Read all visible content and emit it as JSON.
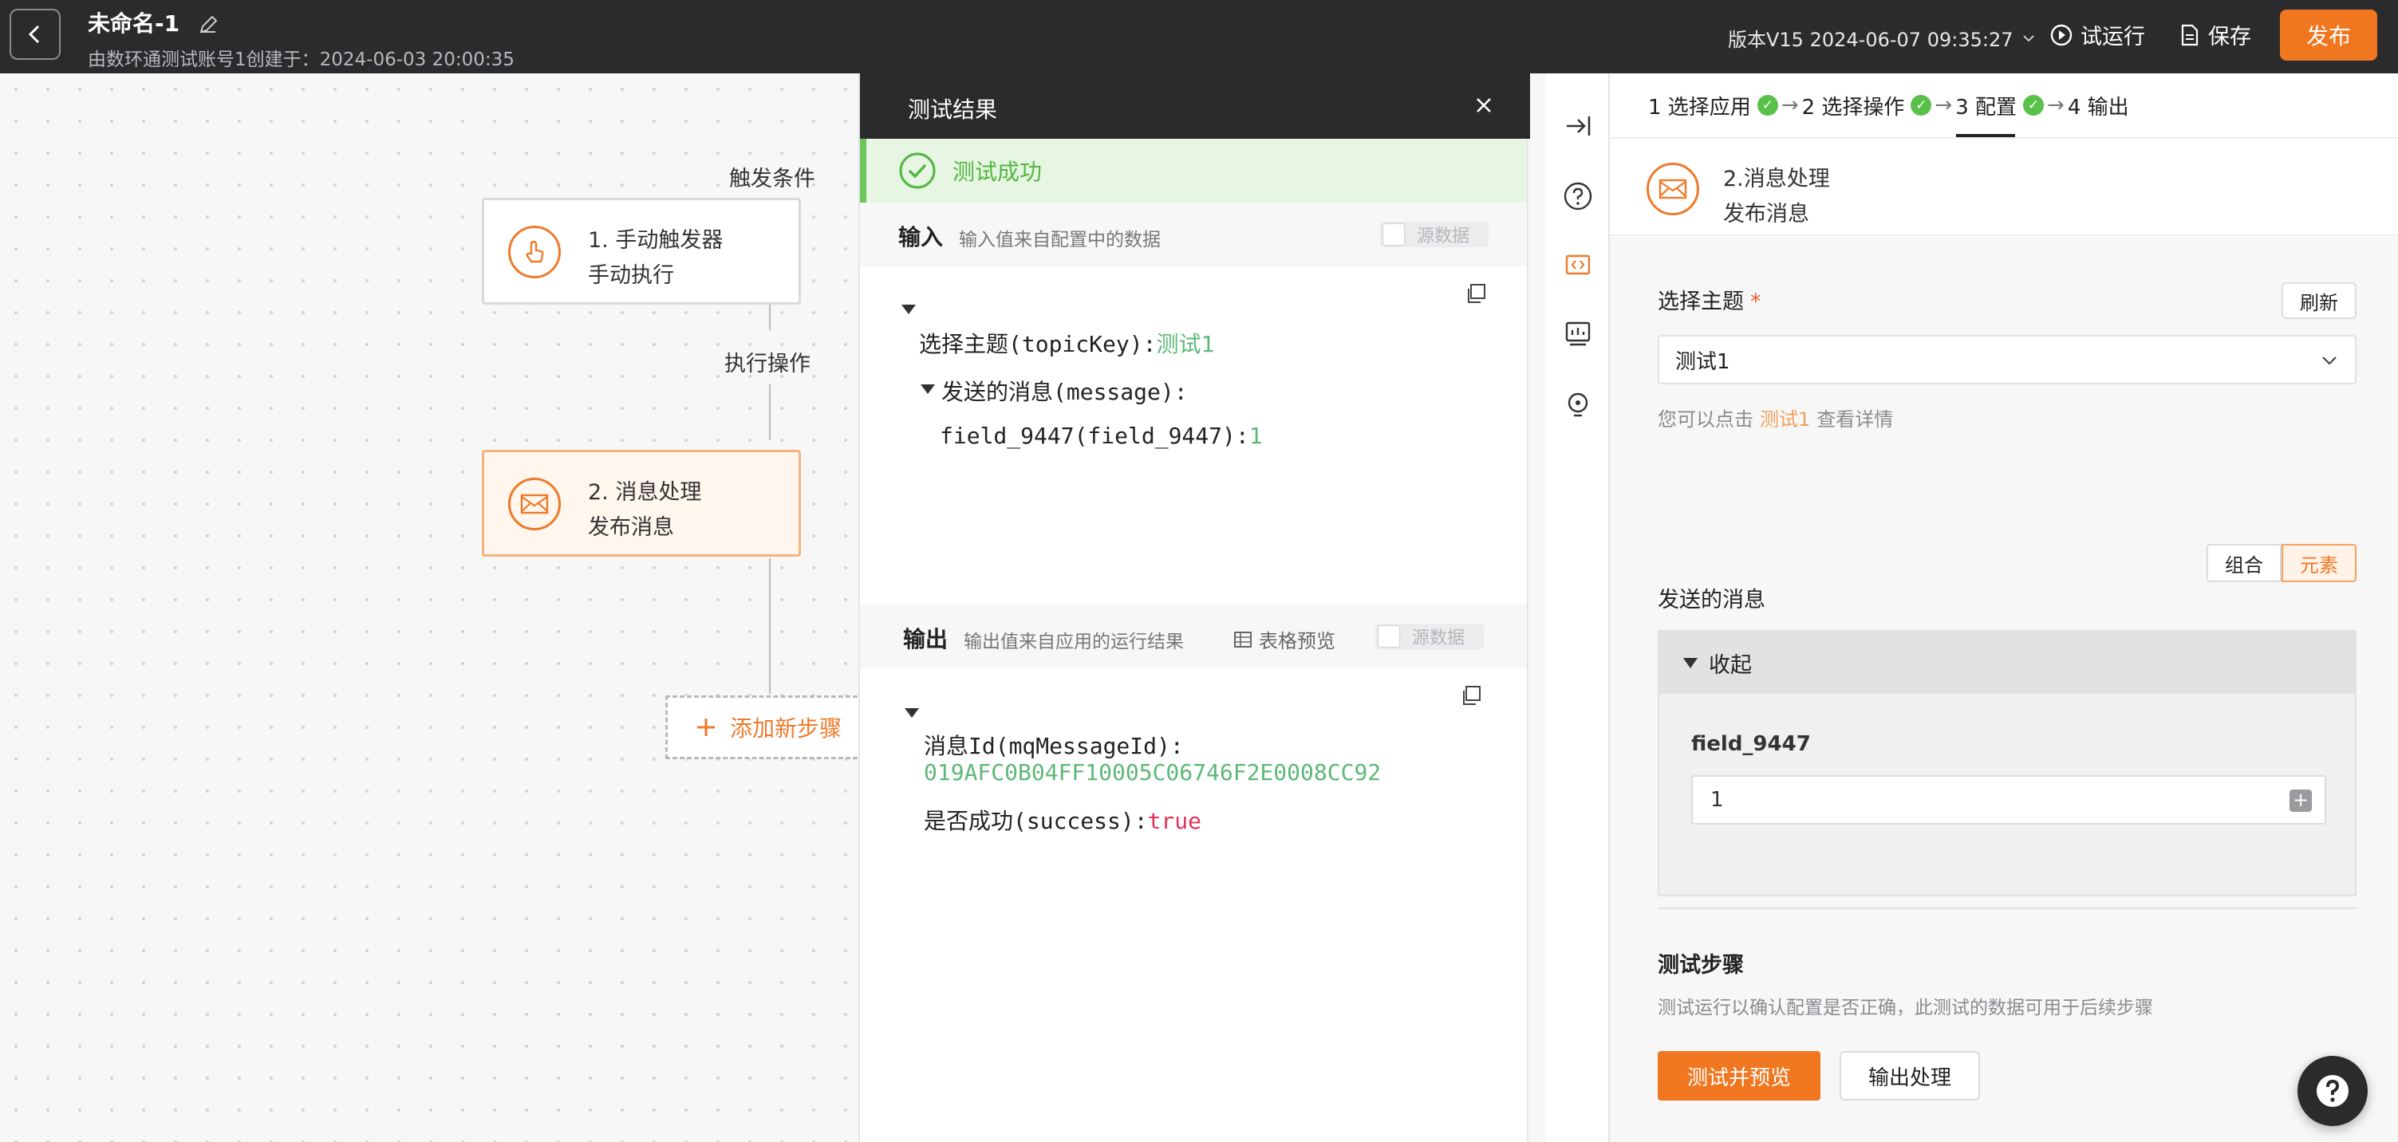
{
  "header": {
    "title": "未命名-1",
    "subtitle": "由数环通测试账号1创建于：2024-06-03 20:00:35",
    "version": "版本V15 2024-06-07 09:35:27",
    "trial_run": "试运行",
    "save": "保存",
    "publish": "发布"
  },
  "canvas": {
    "trigger_label": "触发条件",
    "action_label": "执行操作",
    "node1": {
      "title": "1. 手动触发器",
      "subtitle": "手动执行"
    },
    "node2": {
      "title": "2. 消息处理",
      "subtitle": "发布消息"
    },
    "add_step": "添加新步骤"
  },
  "result_panel": {
    "title": "测试结果",
    "status": "测试成功",
    "input": {
      "title": "输入",
      "desc": "输入值来自配置中的数据",
      "toggle": "源数据",
      "topic_key": "选择主题(topicKey):",
      "topic_value": "测试1",
      "message_key": "发送的消息(message):",
      "field_key": "field_9447(field_9447):",
      "field_value": "1"
    },
    "output": {
      "title": "输出",
      "desc": "输出值来自应用的运行结果",
      "table_preview": "表格预览",
      "toggle": "源数据",
      "msgid_key": "消息Id(mqMessageId):",
      "msgid_value": "019AFC0B04FF10005C06746F2E0008CC92",
      "success_key": "是否成功(success):",
      "success_value": "true"
    }
  },
  "config": {
    "steps": {
      "s1": "1 选择应用",
      "s2": "2 选择操作",
      "s3": "3 配置",
      "s4": "4 输出"
    },
    "action_title": "2.消息处理",
    "action_subtitle": "发布消息",
    "select_topic_label": "选择主题",
    "refresh": "刷新",
    "select_value": "测试1",
    "hint_prefix": "您可以点击",
    "hint_link": "测试1",
    "hint_suffix": "查看详情",
    "seg_combine": "组合",
    "seg_element": "元素",
    "message_label": "发送的消息",
    "collapse": "收起",
    "field_name": "field_9447",
    "field_value": "1",
    "test_step_title": "测试步骤",
    "test_step_desc": "测试运行以确认配置是否正确，此测试的数据可用于后续步骤",
    "test_preview": "测试并预览",
    "output_process": "输出处理"
  },
  "colors": {
    "accent": "#f0771f",
    "success": "#52b53f",
    "topbar": "#2b2b2e"
  }
}
